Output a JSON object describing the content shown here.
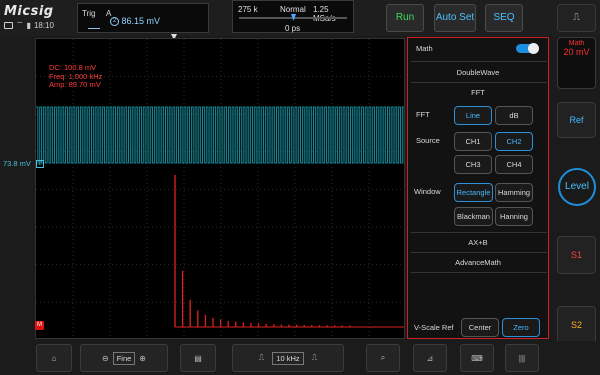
{
  "brand": {
    "logo": "Micsig"
  },
  "status": {
    "time": "18:10"
  },
  "trigger": {
    "label": "Trig",
    "source": "A",
    "channel": "2",
    "value": "86.15 mV"
  },
  "timebase": {
    "memory": "275 k",
    "mode": "Normal",
    "rate": "1.25 MSa/s",
    "offset": "0 ps"
  },
  "topbuttons": {
    "run": "Run",
    "auto": "Auto Set",
    "seq": "SEQ"
  },
  "measurements": {
    "dc": "DC: 100.8 mV",
    "freq": "Freq: 1.000 kHz",
    "amp": "Amp: 89.70 mV"
  },
  "channel": {
    "level": "73.8 mV",
    "number": "2",
    "math_marker": "M"
  },
  "fft_chart": {
    "type": "bar",
    "values": [
      100,
      37,
      18,
      11,
      8,
      6,
      5,
      4,
      3.5,
      3,
      2.6,
      2.3,
      2.1,
      1.9,
      1.7,
      1.6,
      1.5,
      1.4,
      1.3,
      1.2,
      1.15,
      1.1,
      1.05,
      1.0
    ],
    "color": "#e02020"
  },
  "panel": {
    "math_label": "Math",
    "doublewave": "DoubleWave",
    "fft_header": "FFT",
    "fft_label": "FFT",
    "line": "Line",
    "db": "dB",
    "source_label": "Source",
    "ch1": "CH1",
    "ch2": "CH2",
    "ch3": "CH3",
    "ch4": "CH4",
    "window_label": "Window",
    "rectangle": "Rectangle",
    "hamming": "Hamming",
    "blackman": "Blackman",
    "hanning": "Hanning",
    "axb": "AX+B",
    "advancemath": "AdvanceMath",
    "vscale_label": "V-Scale Ref",
    "center": "Center",
    "zero": "Zero"
  },
  "right": {
    "math_title": "Math",
    "math_value": "20 mV",
    "ref": "Ref",
    "level": "Level",
    "s1": "S1",
    "s2": "S2"
  },
  "bottom": {
    "fine": "Fine",
    "freq": "10 kHz"
  },
  "colors": {
    "accent": "#49c0ff",
    "ch2": "#1fb5c9",
    "math": "#e02020"
  }
}
